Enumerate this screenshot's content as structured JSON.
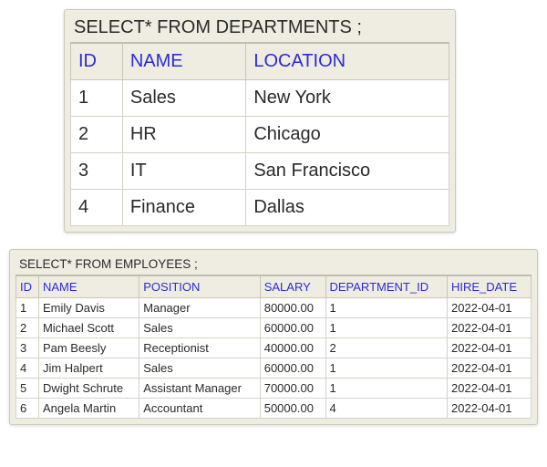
{
  "departments": {
    "query": "SELECT* FROM DEPARTMENTS ;",
    "headers": [
      "ID",
      "NAME",
      "LOCATION"
    ],
    "rows": [
      {
        "id": "1",
        "name": "Sales",
        "location": "New York"
      },
      {
        "id": "2",
        "name": "HR",
        "location": "Chicago"
      },
      {
        "id": "3",
        "name": "IT",
        "location": "San Francisco"
      },
      {
        "id": "4",
        "name": "Finance",
        "location": "Dallas"
      }
    ]
  },
  "employees": {
    "query": "SELECT* FROM EMPLOYEES ;",
    "headers": [
      "ID",
      "NAME",
      "POSITION",
      "SALARY",
      "DEPARTMENT_ID",
      "HIRE_DATE"
    ],
    "rows": [
      {
        "id": "1",
        "name": "Emily Davis",
        "position": "Manager",
        "salary": "80000.00",
        "department_id": "1",
        "hire_date": "2022-04-01"
      },
      {
        "id": "2",
        "name": "Michael Scott",
        "position": "Sales",
        "salary": "60000.00",
        "department_id": "1",
        "hire_date": "2022-04-01"
      },
      {
        "id": "3",
        "name": "Pam Beesly",
        "position": "Receptionist",
        "salary": "40000.00",
        "department_id": "2",
        "hire_date": "2022-04-01"
      },
      {
        "id": "4",
        "name": "Jim Halpert",
        "position": "Sales",
        "salary": "60000.00",
        "department_id": "1",
        "hire_date": "2022-04-01"
      },
      {
        "id": "5",
        "name": "Dwight Schrute",
        "position": "Assistant Manager",
        "salary": "70000.00",
        "department_id": "1",
        "hire_date": "2022-04-01"
      },
      {
        "id": "6",
        "name": "Angela Martin",
        "position": "Accountant",
        "salary": "50000.00",
        "department_id": "4",
        "hire_date": "2022-04-01"
      }
    ]
  }
}
